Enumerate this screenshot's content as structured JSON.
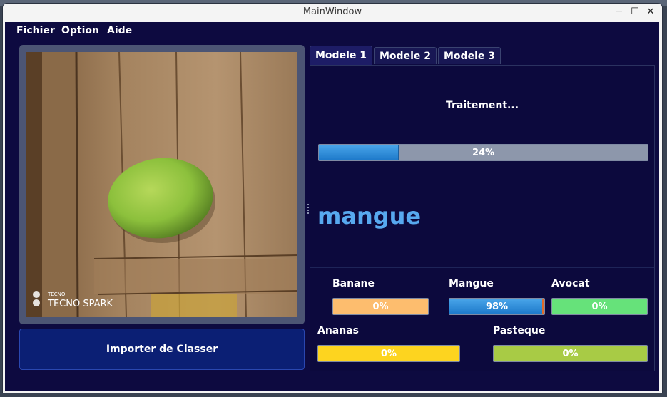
{
  "window": {
    "title": "MainWindow"
  },
  "menu": {
    "items": [
      "Fichier",
      "Option",
      "Aide"
    ]
  },
  "image_panel": {
    "watermark": "TECNO SPARK"
  },
  "import_button": {
    "label": "Importer de Classer"
  },
  "tabs": [
    {
      "label": "Modele 1",
      "active": true
    },
    {
      "label": "Modele 2",
      "active": false
    },
    {
      "label": "Modele 3",
      "active": false
    }
  ],
  "processing": {
    "status": "Traitement...",
    "progress": 24,
    "progress_text": "24%"
  },
  "prediction": {
    "label": "mangue",
    "color": "#57a8ef"
  },
  "classes": [
    {
      "name": "Banane",
      "value": 0,
      "text": "0%",
      "color": "#fdbd6e"
    },
    {
      "name": "Mangue",
      "value": 98,
      "text": "98%",
      "color": "#2e8fdc"
    },
    {
      "name": "Avocat",
      "value": 0,
      "text": "0%",
      "color": "#66e27a"
    },
    {
      "name": "Ananas",
      "value": 0,
      "text": "0%",
      "color": "#fdd41f"
    },
    {
      "name": "Pasteque",
      "value": 0,
      "text": "0%",
      "color": "#a8cb45"
    }
  ]
}
